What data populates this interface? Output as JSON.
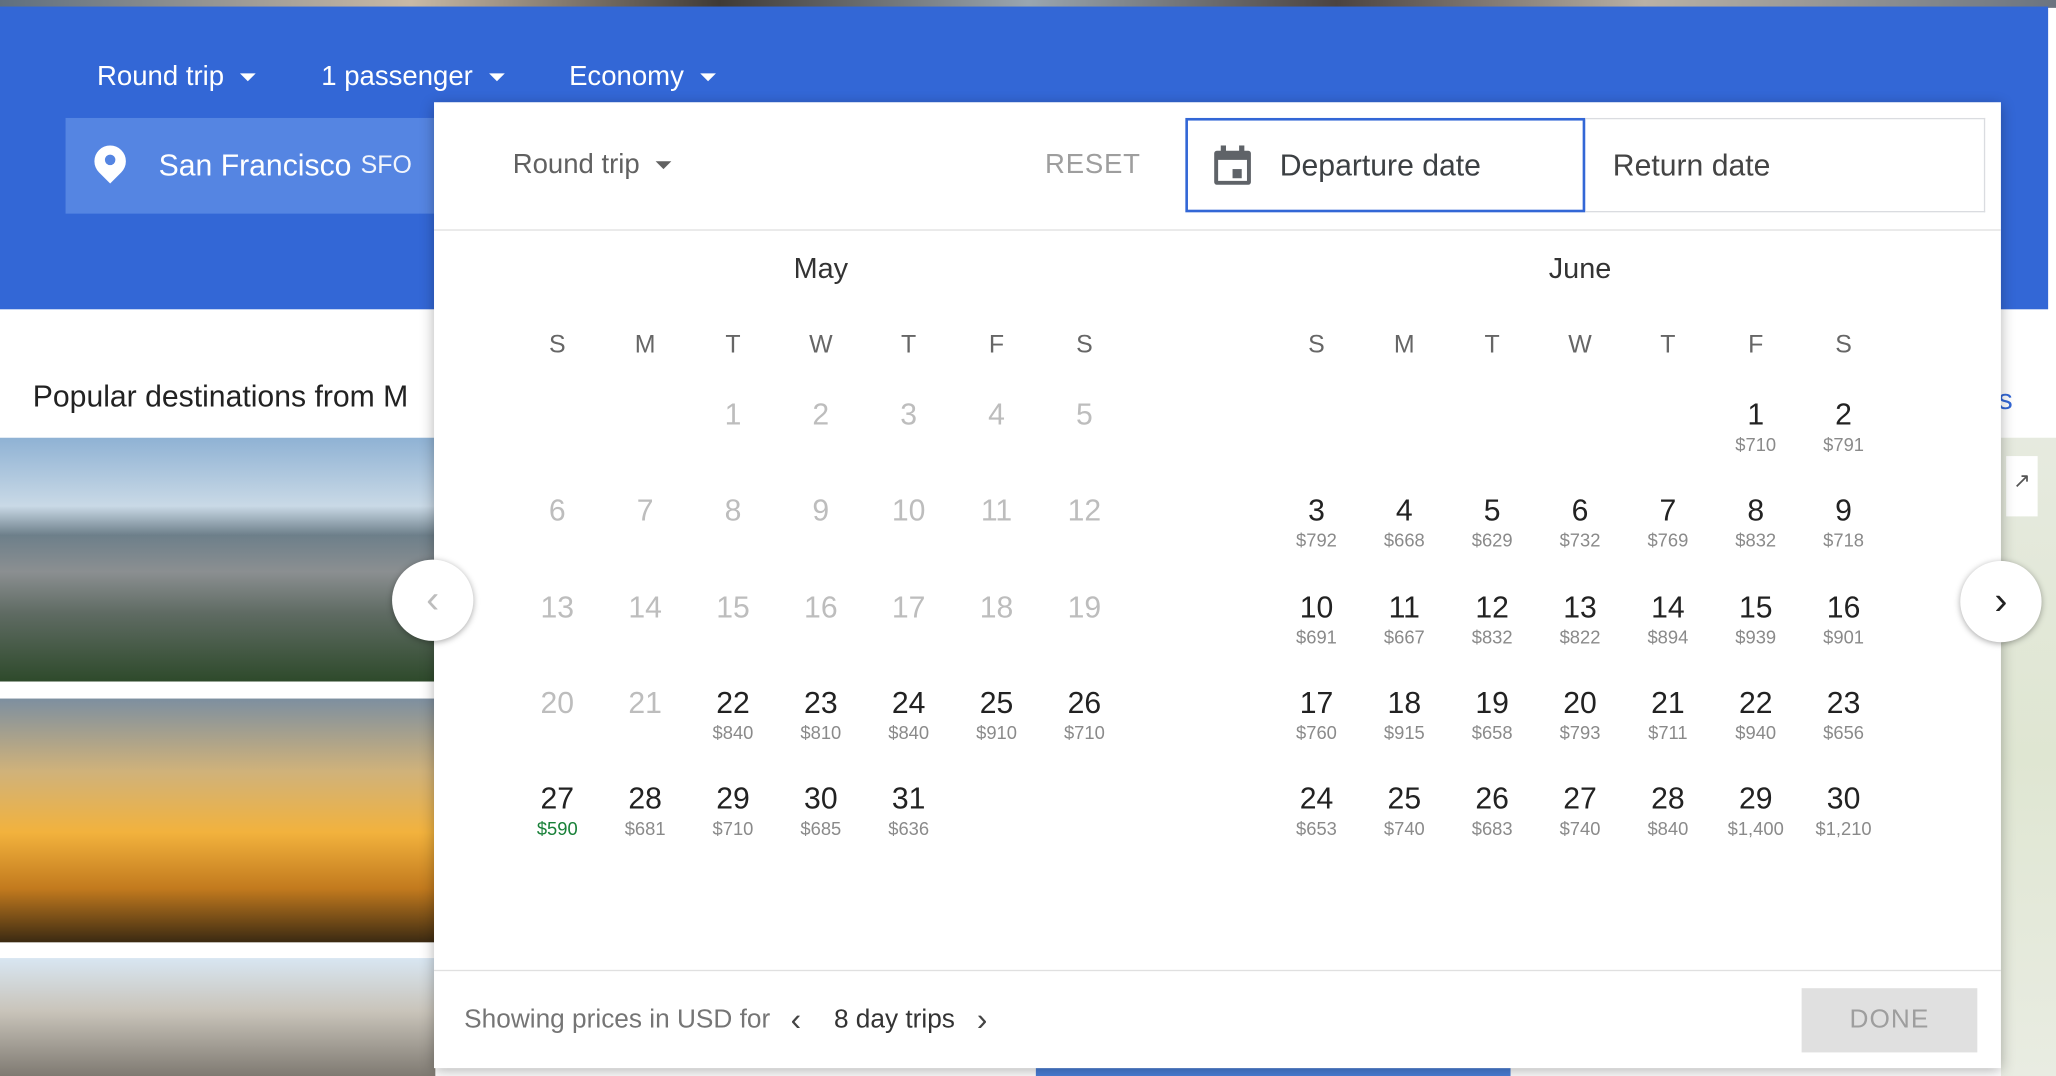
{
  "hero": {
    "trip_type": "Round trip",
    "passengers": "1 passenger",
    "cabin": "Economy",
    "origin_city": "San Francisco",
    "origin_code": "SFO"
  },
  "popular": {
    "title": "Popular destinations from M",
    "right_link": "s"
  },
  "modal": {
    "trip_type": "Round trip",
    "reset_label": "RESET",
    "departure_placeholder": "Departure date",
    "return_placeholder": "Return date",
    "footer_text": "Showing prices in USD for",
    "trip_length": "8 day trips",
    "done_label": "DONE"
  },
  "weekdays": [
    "S",
    "M",
    "T",
    "W",
    "T",
    "F",
    "S"
  ],
  "months": [
    {
      "name": "May",
      "first_weekday": 2,
      "days": [
        {
          "d": "1",
          "price": "",
          "disabled": true
        },
        {
          "d": "2",
          "price": "",
          "disabled": true
        },
        {
          "d": "3",
          "price": "",
          "disabled": true
        },
        {
          "d": "4",
          "price": "",
          "disabled": true
        },
        {
          "d": "5",
          "price": "",
          "disabled": true
        },
        {
          "d": "6",
          "price": "",
          "disabled": true
        },
        {
          "d": "7",
          "price": "",
          "disabled": true
        },
        {
          "d": "8",
          "price": "",
          "disabled": true
        },
        {
          "d": "9",
          "price": "",
          "disabled": true
        },
        {
          "d": "10",
          "price": "",
          "disabled": true
        },
        {
          "d": "11",
          "price": "",
          "disabled": true
        },
        {
          "d": "12",
          "price": "",
          "disabled": true
        },
        {
          "d": "13",
          "price": "",
          "disabled": true
        },
        {
          "d": "14",
          "price": "",
          "disabled": true
        },
        {
          "d": "15",
          "price": "",
          "disabled": true
        },
        {
          "d": "16",
          "price": "",
          "disabled": true
        },
        {
          "d": "17",
          "price": "",
          "disabled": true
        },
        {
          "d": "18",
          "price": "",
          "disabled": true
        },
        {
          "d": "19",
          "price": "",
          "disabled": true
        },
        {
          "d": "20",
          "price": "",
          "disabled": true
        },
        {
          "d": "21",
          "price": "",
          "disabled": true
        },
        {
          "d": "22",
          "price": "$840"
        },
        {
          "d": "23",
          "price": "$810"
        },
        {
          "d": "24",
          "price": "$840"
        },
        {
          "d": "25",
          "price": "$910"
        },
        {
          "d": "26",
          "price": "$710"
        },
        {
          "d": "27",
          "price": "$590",
          "cheapest": true
        },
        {
          "d": "28",
          "price": "$681"
        },
        {
          "d": "29",
          "price": "$710"
        },
        {
          "d": "30",
          "price": "$685"
        },
        {
          "d": "31",
          "price": "$636"
        }
      ]
    },
    {
      "name": "June",
      "first_weekday": 5,
      "days": [
        {
          "d": "1",
          "price": "$710"
        },
        {
          "d": "2",
          "price": "$791"
        },
        {
          "d": "3",
          "price": "$792"
        },
        {
          "d": "4",
          "price": "$668"
        },
        {
          "d": "5",
          "price": "$629"
        },
        {
          "d": "6",
          "price": "$732"
        },
        {
          "d": "7",
          "price": "$769"
        },
        {
          "d": "8",
          "price": "$832"
        },
        {
          "d": "9",
          "price": "$718"
        },
        {
          "d": "10",
          "price": "$691"
        },
        {
          "d": "11",
          "price": "$667"
        },
        {
          "d": "12",
          "price": "$832"
        },
        {
          "d": "13",
          "price": "$822"
        },
        {
          "d": "14",
          "price": "$894"
        },
        {
          "d": "15",
          "price": "$939"
        },
        {
          "d": "16",
          "price": "$901"
        },
        {
          "d": "17",
          "price": "$760"
        },
        {
          "d": "18",
          "price": "$915"
        },
        {
          "d": "19",
          "price": "$658"
        },
        {
          "d": "20",
          "price": "$793"
        },
        {
          "d": "21",
          "price": "$711"
        },
        {
          "d": "22",
          "price": "$940"
        },
        {
          "d": "23",
          "price": "$656"
        },
        {
          "d": "24",
          "price": "$653"
        },
        {
          "d": "25",
          "price": "$740"
        },
        {
          "d": "26",
          "price": "$683"
        },
        {
          "d": "27",
          "price": "$740"
        },
        {
          "d": "28",
          "price": "$840"
        },
        {
          "d": "29",
          "price": "$1,400"
        },
        {
          "d": "30",
          "price": "$1,210"
        }
      ]
    }
  ],
  "icons": {
    "origin": "location-pin-icon",
    "calendar": "calendar-icon",
    "prev": "chevron-left-icon",
    "next": "chevron-right-icon"
  },
  "colors": {
    "brand_blue": "#3367d6",
    "cheapest_green": "#188038",
    "disabled_text": "#bdbdbd"
  }
}
